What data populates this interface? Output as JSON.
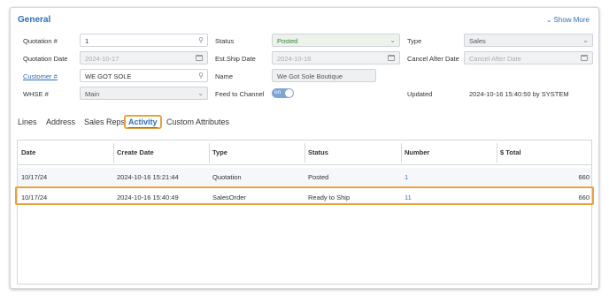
{
  "header": {
    "title": "General",
    "show_more": "Show More"
  },
  "form": {
    "quotation_label": "Quotation #",
    "quotation_value": "1",
    "quotation_date_label": "Quotation Date",
    "quotation_date_value": "2024-10-17",
    "customer_label": "Customer #",
    "customer_value": "WE GOT SOLE",
    "whse_label": "WHSE #",
    "whse_value": "Main",
    "status_label": "Status",
    "status_value": "Posted",
    "est_ship_label": "Est.Ship Date",
    "est_ship_value": "2024-10-16",
    "name_label": "Name",
    "name_value": "We Got Sole Boutique",
    "feed_label": "Feed to Channel",
    "feed_value": "on",
    "type_label": "Type",
    "type_value": "Sales",
    "cancel_label": "Cancel After Date",
    "cancel_placeholder": "Cancel After Date",
    "updated_label": "Updated",
    "updated_value": "2024-10-16 15:40:50 by SYSTEM"
  },
  "tabs": [
    {
      "label": "Lines"
    },
    {
      "label": "Address"
    },
    {
      "label": "Sales Reps"
    },
    {
      "label": "Activity"
    },
    {
      "label": "Custom Attributes"
    }
  ],
  "table": {
    "columns": [
      "Date",
      "Create Date",
      "Type",
      "Status",
      "Number",
      "$ Total"
    ],
    "rows": [
      {
        "date": "10/17/24",
        "create_date": "2024-10-16 15:21:44",
        "type": "Quotation",
        "status": "Posted",
        "number": "1",
        "total": "660"
      },
      {
        "date": "10/17/24",
        "create_date": "2024-10-16 15:40:49",
        "type": "SalesOrder",
        "status": "Ready to Ship",
        "number": "11",
        "total": "660"
      }
    ]
  }
}
